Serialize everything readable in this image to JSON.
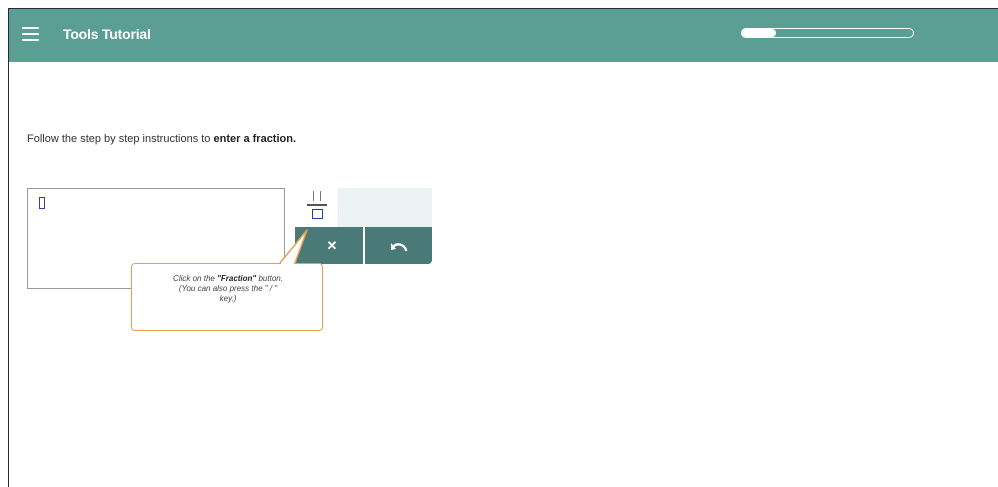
{
  "header": {
    "menu_icon": "hamburger-menu-icon",
    "title": "Tools Tutorial",
    "progress_fraction": 0.2,
    "colors": {
      "bar": "#5a9e94",
      "text": "#ffffff"
    }
  },
  "instruction": {
    "prefix": "Follow the step by step instructions to",
    "emphasis": "enter a fraction."
  },
  "toolbar": {
    "fraction_icon": "fraction-template-icon",
    "clear_symbol": "✕",
    "clear_icon": "close-icon",
    "undo_icon": "undo-icon",
    "colors": {
      "action_bar": "#497a78",
      "panel": "#edf2f2"
    }
  },
  "callout": {
    "line1_prefix": "Click on the",
    "line1_bold": "\"Fraction\"",
    "line1_suffix": "button.",
    "line2": "(You can also press the \" / \"",
    "line3": "key.)",
    "border_color": "#e8a050"
  }
}
